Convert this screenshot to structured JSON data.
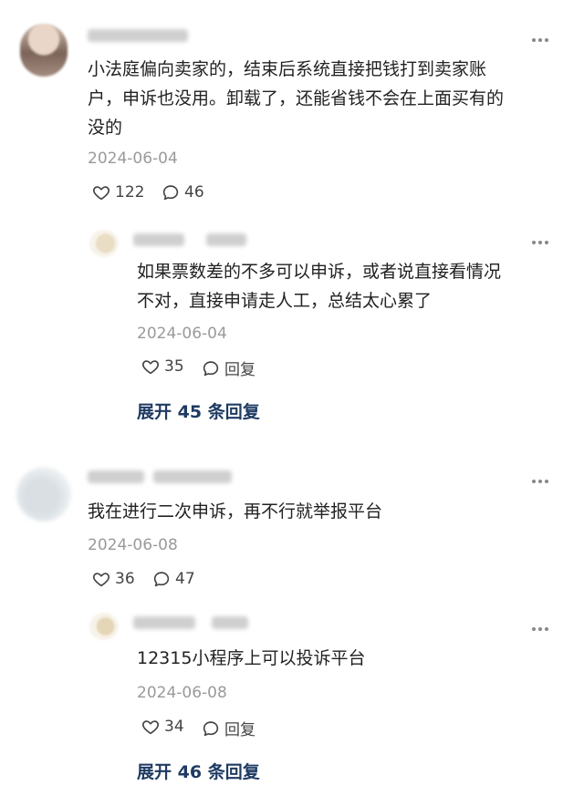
{
  "comments": [
    {
      "text": "小法庭偏向卖家的，结束后系统直接把钱打到卖家账户，申诉也没用。卸载了，还能省钱不会在上面买有的没的",
      "text_line1": "小法庭偏向卖家的，结束后系统直接把钱打到卖家账",
      "text_line2": "户，申诉也没用。卸载了，还能省钱不会在上面买有的",
      "text_line3": "没的",
      "date": "2024-06-04",
      "likes": "122",
      "replies": "46",
      "reply": {
        "text_line1": "如果票数差的不多可以申诉，或者说直接看情况",
        "text_line2": "不对，直接申请走人工，总结太心累了",
        "date": "2024-06-04",
        "likes": "35",
        "reply_label": "回复"
      },
      "expand": {
        "prefix": "展开",
        "count": "45",
        "suffix": "条回复"
      }
    },
    {
      "text": "我在进行二次申诉，再不行就举报平台",
      "date": "2024-06-08",
      "likes": "36",
      "replies": "47",
      "reply": {
        "text_line1": "12315小程序上可以投诉平台",
        "date": "2024-06-08",
        "likes": "34",
        "reply_label": "回复"
      },
      "expand": {
        "prefix": "展开",
        "count": "46",
        "suffix": "条回复"
      }
    }
  ],
  "more_glyph": "⋮",
  "icons": {
    "like": "heart-icon",
    "comment": "comment-icon",
    "more": "more-dots-icon"
  }
}
